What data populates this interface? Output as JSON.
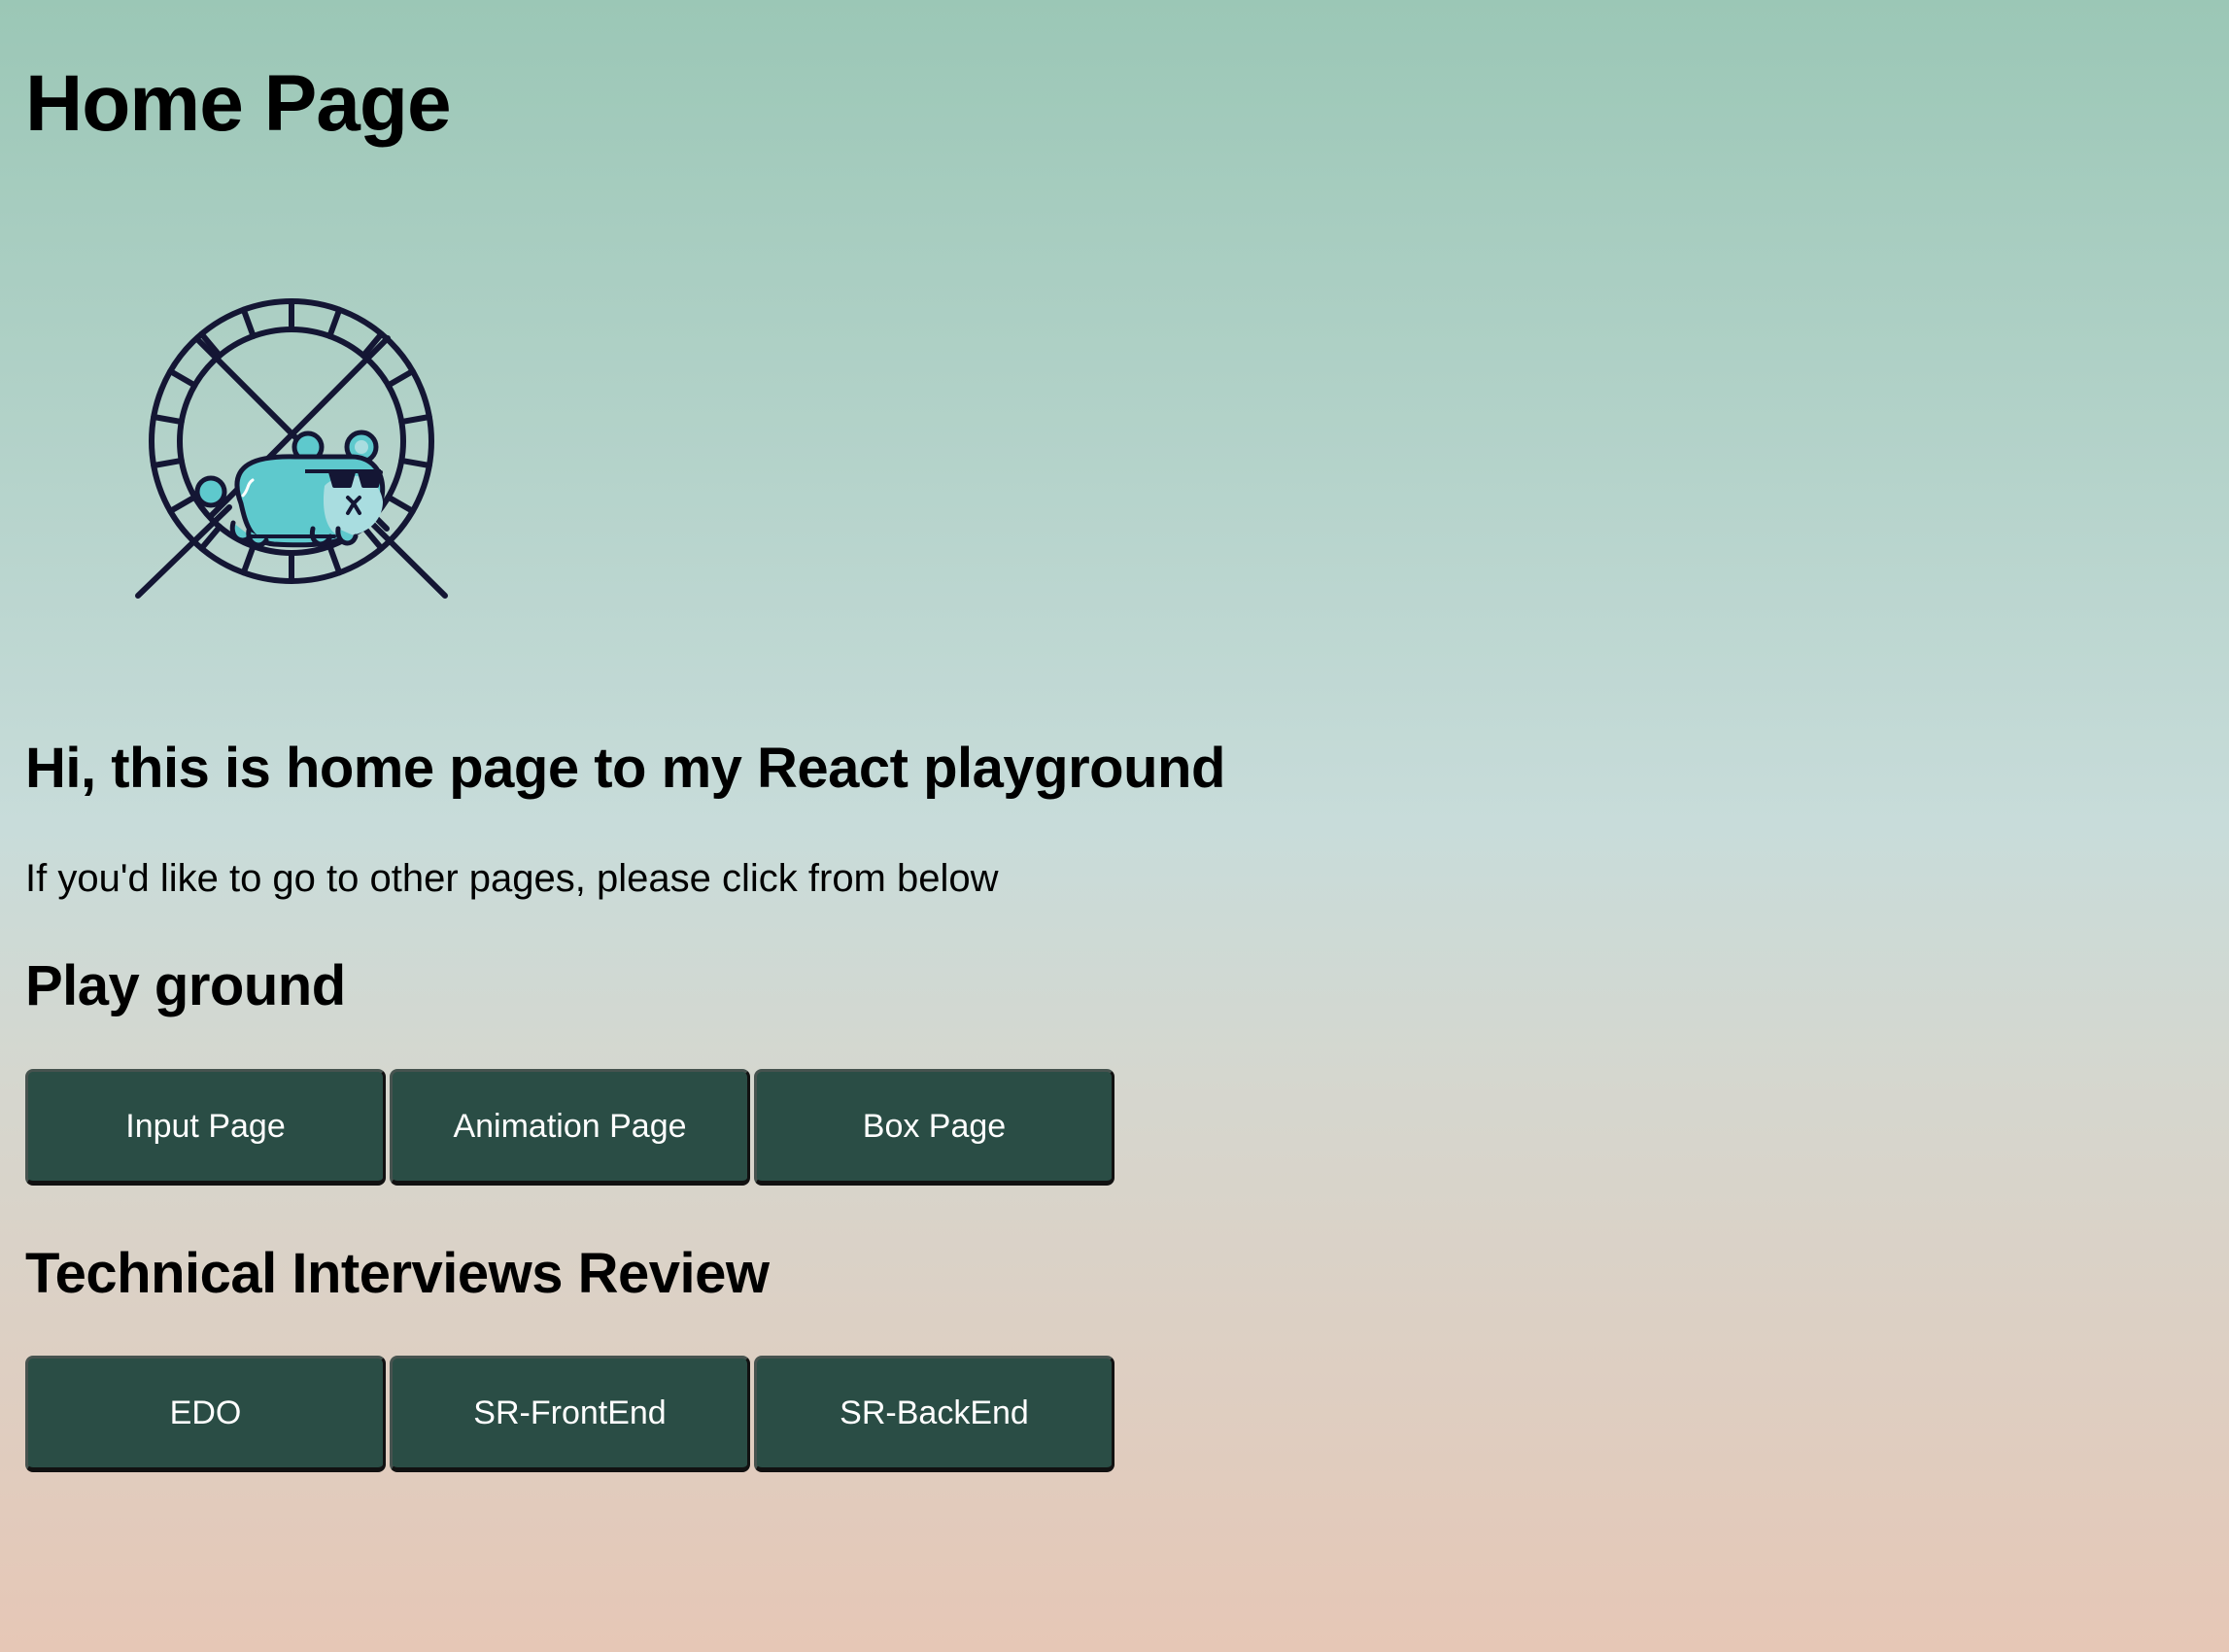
{
  "header": {
    "title": "Home Page"
  },
  "hero": {
    "illustration": "hamster-wheel-illustration"
  },
  "intro": {
    "heading": "Hi, this is home page to my React playground",
    "text": "If you'd like to go to other pages, please click from below"
  },
  "sections": [
    {
      "title": "Play ground",
      "buttons": [
        {
          "label": "Input Page"
        },
        {
          "label": "Animation Page"
        },
        {
          "label": "Box Page"
        }
      ]
    },
    {
      "title": "Technical Interviews Review",
      "buttons": [
        {
          "label": "EDO"
        },
        {
          "label": "SR-FrontEnd"
        },
        {
          "label": "SR-BackEnd"
        }
      ]
    }
  ],
  "colors": {
    "background_top": "#9bc7b6",
    "background_bottom": "#e6c7b6",
    "button_bg": "#2a4d45",
    "button_text": "#ffffff",
    "hamster": "#5ec9cd"
  }
}
